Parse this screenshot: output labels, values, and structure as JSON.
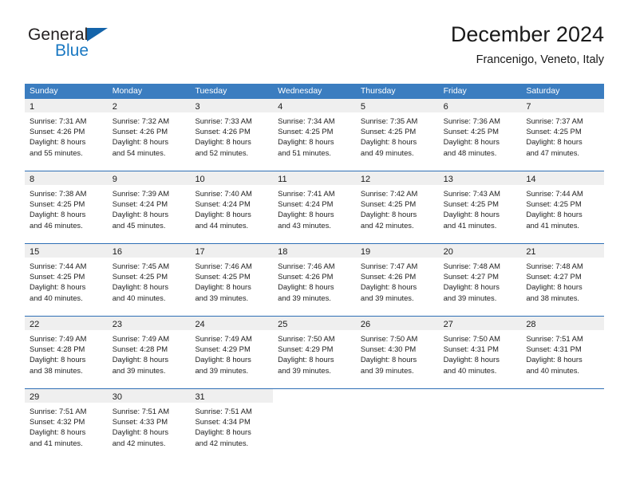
{
  "brand": {
    "name_top": "General",
    "name_bottom": "Blue",
    "accent_color": "#1a78c2",
    "triangle_color": "#1464aa"
  },
  "header": {
    "month_title": "December 2024",
    "location": "Francenigo, Veneto, Italy"
  },
  "theme": {
    "header_row_bg": "#3b7dc0",
    "week_divider": "#2f6fb5",
    "daynum_band_bg": "#efefef",
    "page_bg": "#ffffff",
    "text_color": "#1a1a1a"
  },
  "weekdays": [
    "Sunday",
    "Monday",
    "Tuesday",
    "Wednesday",
    "Thursday",
    "Friday",
    "Saturday"
  ],
  "weeks": [
    [
      {
        "day": "1",
        "sunrise": "Sunrise: 7:31 AM",
        "sunset": "Sunset: 4:26 PM",
        "daylight1": "Daylight: 8 hours",
        "daylight2": "and 55 minutes."
      },
      {
        "day": "2",
        "sunrise": "Sunrise: 7:32 AM",
        "sunset": "Sunset: 4:26 PM",
        "daylight1": "Daylight: 8 hours",
        "daylight2": "and 54 minutes."
      },
      {
        "day": "3",
        "sunrise": "Sunrise: 7:33 AM",
        "sunset": "Sunset: 4:26 PM",
        "daylight1": "Daylight: 8 hours",
        "daylight2": "and 52 minutes."
      },
      {
        "day": "4",
        "sunrise": "Sunrise: 7:34 AM",
        "sunset": "Sunset: 4:25 PM",
        "daylight1": "Daylight: 8 hours",
        "daylight2": "and 51 minutes."
      },
      {
        "day": "5",
        "sunrise": "Sunrise: 7:35 AM",
        "sunset": "Sunset: 4:25 PM",
        "daylight1": "Daylight: 8 hours",
        "daylight2": "and 49 minutes."
      },
      {
        "day": "6",
        "sunrise": "Sunrise: 7:36 AM",
        "sunset": "Sunset: 4:25 PM",
        "daylight1": "Daylight: 8 hours",
        "daylight2": "and 48 minutes."
      },
      {
        "day": "7",
        "sunrise": "Sunrise: 7:37 AM",
        "sunset": "Sunset: 4:25 PM",
        "daylight1": "Daylight: 8 hours",
        "daylight2": "and 47 minutes."
      }
    ],
    [
      {
        "day": "8",
        "sunrise": "Sunrise: 7:38 AM",
        "sunset": "Sunset: 4:25 PM",
        "daylight1": "Daylight: 8 hours",
        "daylight2": "and 46 minutes."
      },
      {
        "day": "9",
        "sunrise": "Sunrise: 7:39 AM",
        "sunset": "Sunset: 4:24 PM",
        "daylight1": "Daylight: 8 hours",
        "daylight2": "and 45 minutes."
      },
      {
        "day": "10",
        "sunrise": "Sunrise: 7:40 AM",
        "sunset": "Sunset: 4:24 PM",
        "daylight1": "Daylight: 8 hours",
        "daylight2": "and 44 minutes."
      },
      {
        "day": "11",
        "sunrise": "Sunrise: 7:41 AM",
        "sunset": "Sunset: 4:24 PM",
        "daylight1": "Daylight: 8 hours",
        "daylight2": "and 43 minutes."
      },
      {
        "day": "12",
        "sunrise": "Sunrise: 7:42 AM",
        "sunset": "Sunset: 4:25 PM",
        "daylight1": "Daylight: 8 hours",
        "daylight2": "and 42 minutes."
      },
      {
        "day": "13",
        "sunrise": "Sunrise: 7:43 AM",
        "sunset": "Sunset: 4:25 PM",
        "daylight1": "Daylight: 8 hours",
        "daylight2": "and 41 minutes."
      },
      {
        "day": "14",
        "sunrise": "Sunrise: 7:44 AM",
        "sunset": "Sunset: 4:25 PM",
        "daylight1": "Daylight: 8 hours",
        "daylight2": "and 41 minutes."
      }
    ],
    [
      {
        "day": "15",
        "sunrise": "Sunrise: 7:44 AM",
        "sunset": "Sunset: 4:25 PM",
        "daylight1": "Daylight: 8 hours",
        "daylight2": "and 40 minutes."
      },
      {
        "day": "16",
        "sunrise": "Sunrise: 7:45 AM",
        "sunset": "Sunset: 4:25 PM",
        "daylight1": "Daylight: 8 hours",
        "daylight2": "and 40 minutes."
      },
      {
        "day": "17",
        "sunrise": "Sunrise: 7:46 AM",
        "sunset": "Sunset: 4:25 PM",
        "daylight1": "Daylight: 8 hours",
        "daylight2": "and 39 minutes."
      },
      {
        "day": "18",
        "sunrise": "Sunrise: 7:46 AM",
        "sunset": "Sunset: 4:26 PM",
        "daylight1": "Daylight: 8 hours",
        "daylight2": "and 39 minutes."
      },
      {
        "day": "19",
        "sunrise": "Sunrise: 7:47 AM",
        "sunset": "Sunset: 4:26 PM",
        "daylight1": "Daylight: 8 hours",
        "daylight2": "and 39 minutes."
      },
      {
        "day": "20",
        "sunrise": "Sunrise: 7:48 AM",
        "sunset": "Sunset: 4:27 PM",
        "daylight1": "Daylight: 8 hours",
        "daylight2": "and 39 minutes."
      },
      {
        "day": "21",
        "sunrise": "Sunrise: 7:48 AM",
        "sunset": "Sunset: 4:27 PM",
        "daylight1": "Daylight: 8 hours",
        "daylight2": "and 38 minutes."
      }
    ],
    [
      {
        "day": "22",
        "sunrise": "Sunrise: 7:49 AM",
        "sunset": "Sunset: 4:28 PM",
        "daylight1": "Daylight: 8 hours",
        "daylight2": "and 38 minutes."
      },
      {
        "day": "23",
        "sunrise": "Sunrise: 7:49 AM",
        "sunset": "Sunset: 4:28 PM",
        "daylight1": "Daylight: 8 hours",
        "daylight2": "and 39 minutes."
      },
      {
        "day": "24",
        "sunrise": "Sunrise: 7:49 AM",
        "sunset": "Sunset: 4:29 PM",
        "daylight1": "Daylight: 8 hours",
        "daylight2": "and 39 minutes."
      },
      {
        "day": "25",
        "sunrise": "Sunrise: 7:50 AM",
        "sunset": "Sunset: 4:29 PM",
        "daylight1": "Daylight: 8 hours",
        "daylight2": "and 39 minutes."
      },
      {
        "day": "26",
        "sunrise": "Sunrise: 7:50 AM",
        "sunset": "Sunset: 4:30 PM",
        "daylight1": "Daylight: 8 hours",
        "daylight2": "and 39 minutes."
      },
      {
        "day": "27",
        "sunrise": "Sunrise: 7:50 AM",
        "sunset": "Sunset: 4:31 PM",
        "daylight1": "Daylight: 8 hours",
        "daylight2": "and 40 minutes."
      },
      {
        "day": "28",
        "sunrise": "Sunrise: 7:51 AM",
        "sunset": "Sunset: 4:31 PM",
        "daylight1": "Daylight: 8 hours",
        "daylight2": "and 40 minutes."
      }
    ],
    [
      {
        "day": "29",
        "sunrise": "Sunrise: 7:51 AM",
        "sunset": "Sunset: 4:32 PM",
        "daylight1": "Daylight: 8 hours",
        "daylight2": "and 41 minutes."
      },
      {
        "day": "30",
        "sunrise": "Sunrise: 7:51 AM",
        "sunset": "Sunset: 4:33 PM",
        "daylight1": "Daylight: 8 hours",
        "daylight2": "and 42 minutes."
      },
      {
        "day": "31",
        "sunrise": "Sunrise: 7:51 AM",
        "sunset": "Sunset: 4:34 PM",
        "daylight1": "Daylight: 8 hours",
        "daylight2": "and 42 minutes."
      },
      {
        "day": "",
        "sunrise": "",
        "sunset": "",
        "daylight1": "",
        "daylight2": ""
      },
      {
        "day": "",
        "sunrise": "",
        "sunset": "",
        "daylight1": "",
        "daylight2": ""
      },
      {
        "day": "",
        "sunrise": "",
        "sunset": "",
        "daylight1": "",
        "daylight2": ""
      },
      {
        "day": "",
        "sunrise": "",
        "sunset": "",
        "daylight1": "",
        "daylight2": ""
      }
    ]
  ]
}
